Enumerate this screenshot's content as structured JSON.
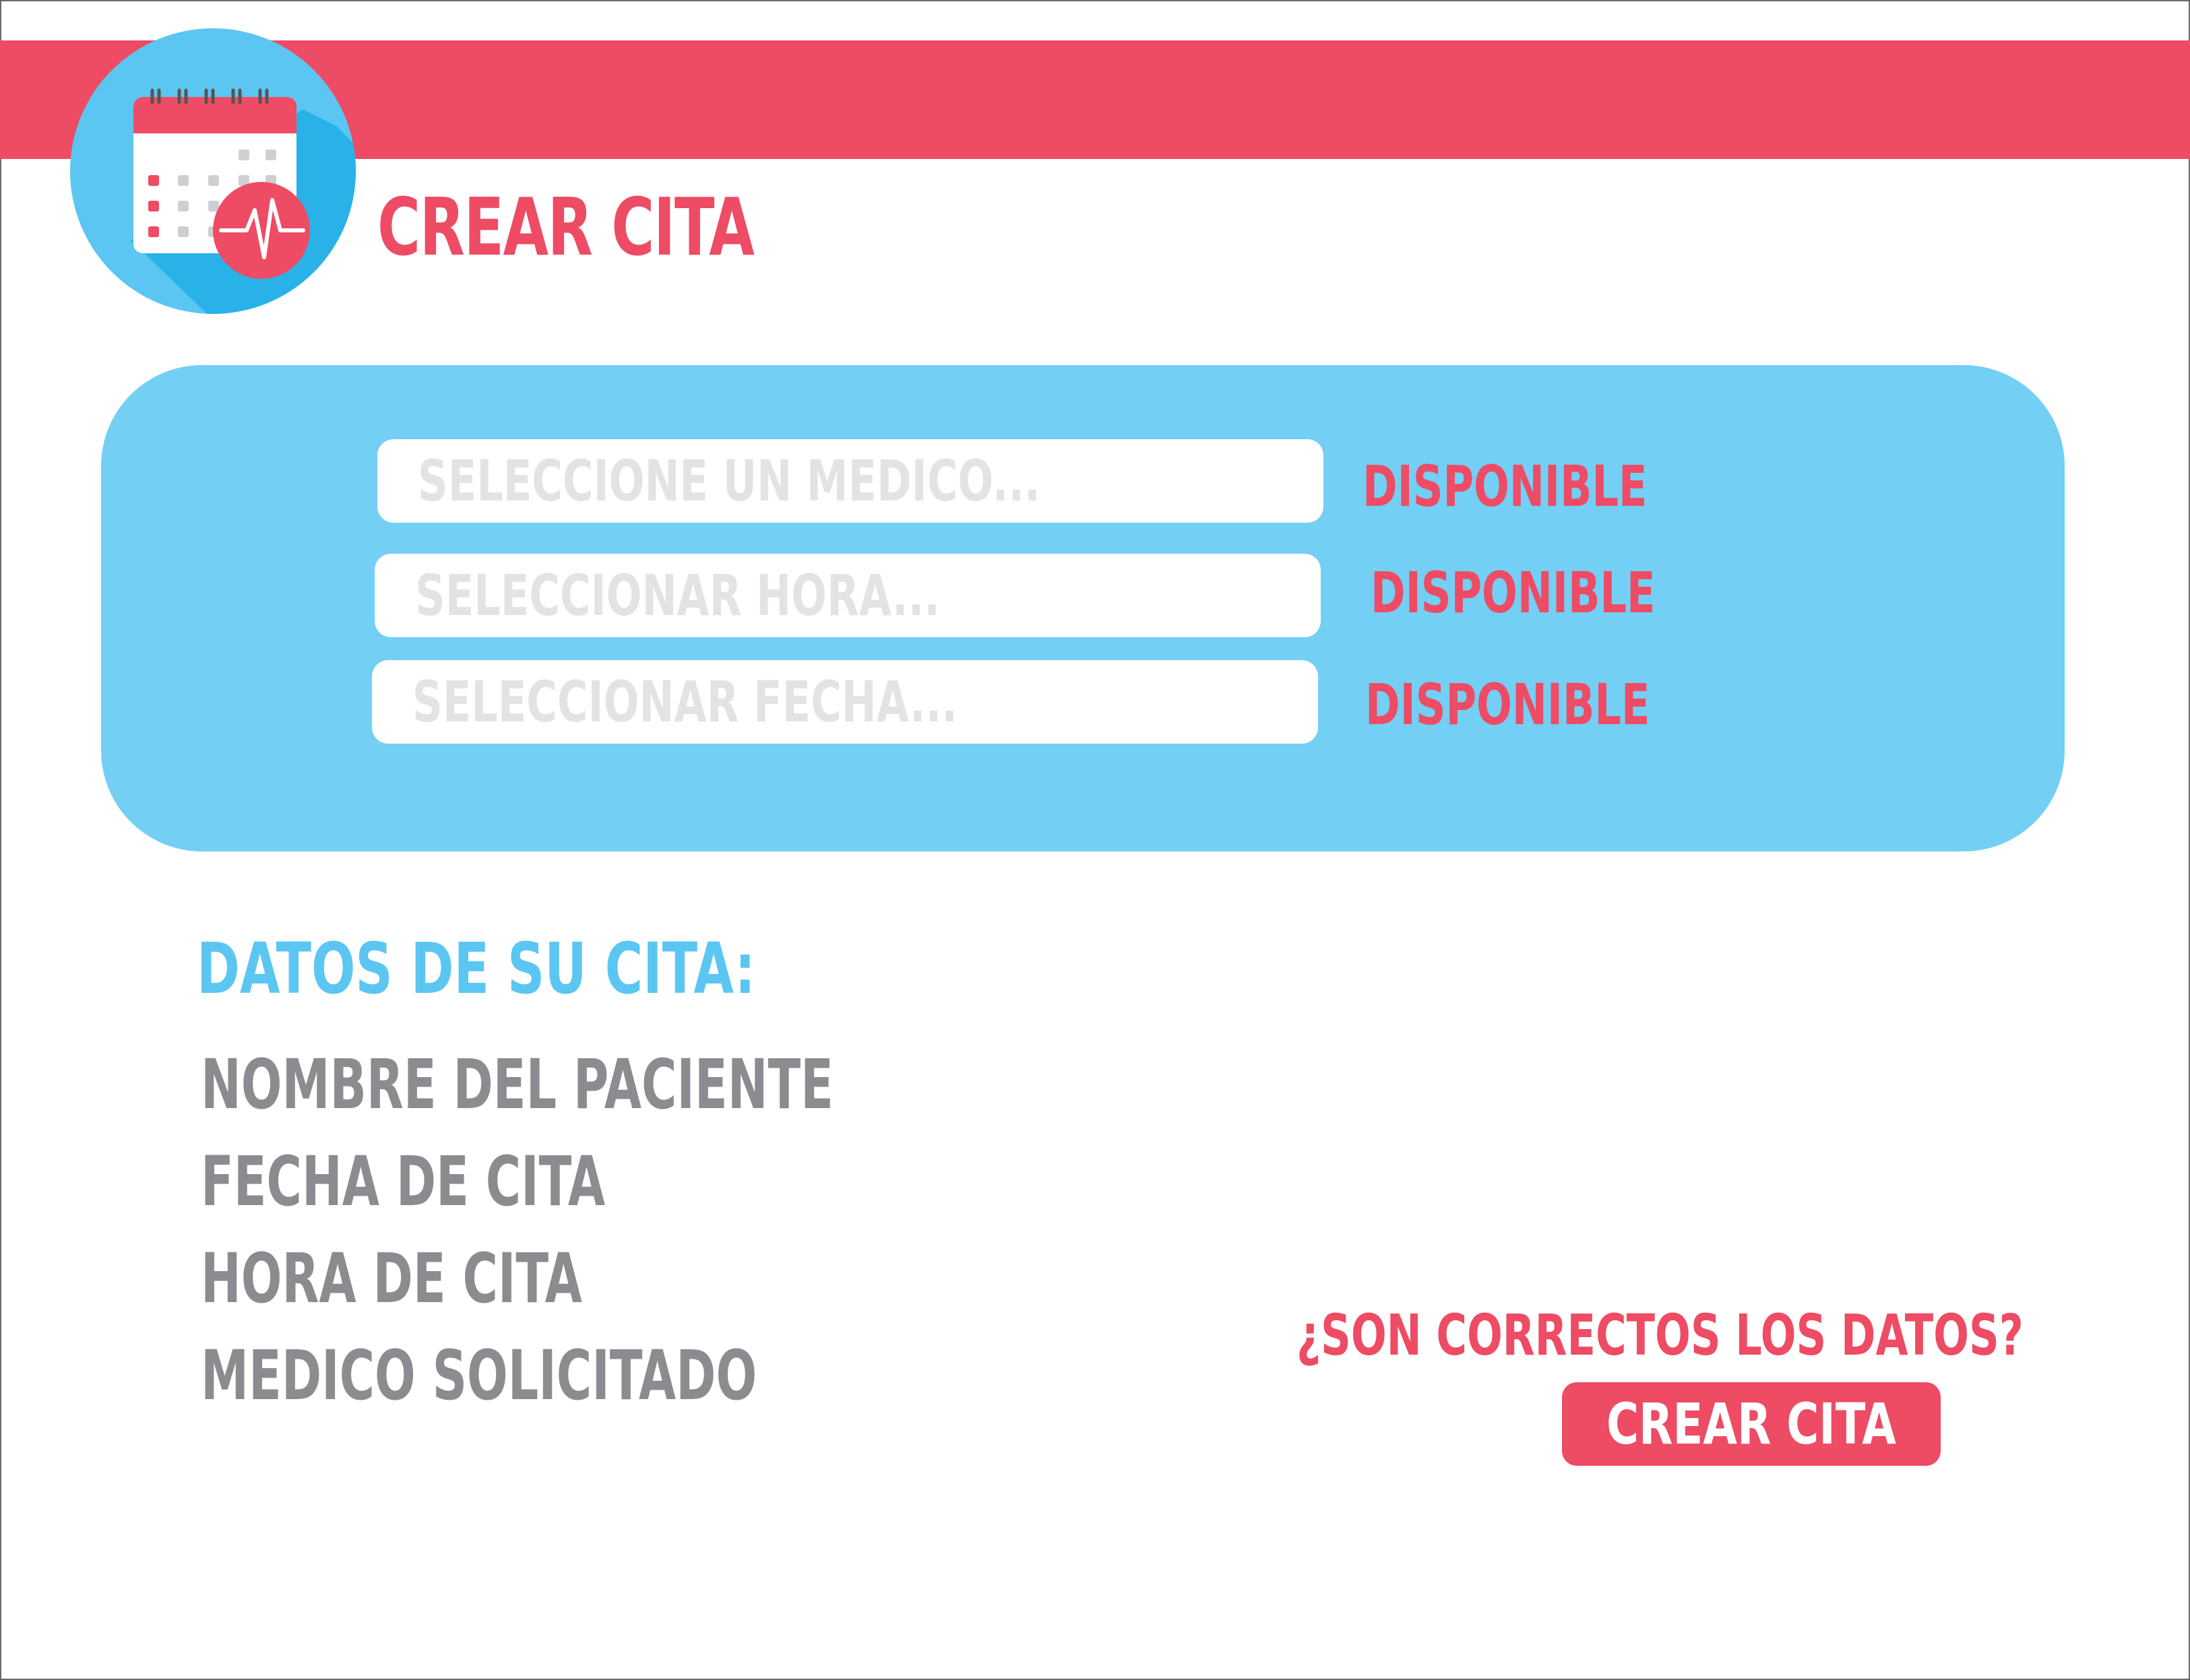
{
  "header": {
    "title": "CREAR CITA",
    "logo_icon": "calendar-heartbeat-icon"
  },
  "form": {
    "medico": {
      "placeholder": "SELECCIONE UN MEDICO...",
      "status": "DISPONIBLE"
    },
    "hora": {
      "placeholder": "SELECCIONAR HORA...",
      "status": "DISPONIBLE"
    },
    "fecha": {
      "placeholder": "SELECCIONAR FECHA...",
      "status": "DISPONIBLE"
    }
  },
  "summary": {
    "title": "DATOS DE SU CITA:",
    "items": [
      "NOMBRE DEL PACIENTE",
      "FECHA DE CITA",
      "HORA DE CITA",
      "MEDICO SOLICITADO"
    ]
  },
  "confirm": {
    "question": "¿SON CORRECTOS LOS DATOS?",
    "button_label": "CREAR CITA"
  },
  "colors": {
    "accent": "#ee4b64",
    "panel": "#73cff4",
    "heading_blue": "#5bc6f2",
    "text_gray": "#8b8c90",
    "placeholder_gray": "#e3e3e3"
  }
}
